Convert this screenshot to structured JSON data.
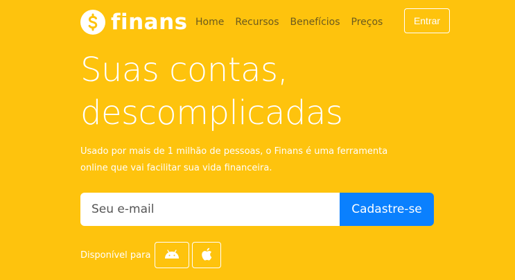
{
  "brand": {
    "name": "finans",
    "logo_icon": "dollar-coin-icon"
  },
  "nav": {
    "items": [
      {
        "label": "Home"
      },
      {
        "label": "Recursos"
      },
      {
        "label": "Benefícios"
      },
      {
        "label": "Preços"
      }
    ],
    "login_label": "Entrar"
  },
  "hero": {
    "headline_line1": "Suas contas,",
    "headline_line2": "descomplicadas",
    "subtitle": "Usado por mais de 1 milhão de pessoas, o Finans é uma ferramenta online que vai facilitar sua vida financeira."
  },
  "signup": {
    "placeholder": "Seu e-mail",
    "button_label": "Cadastre-se"
  },
  "availability": {
    "label": "Disponível para",
    "platforms": [
      {
        "icon": "android-icon"
      },
      {
        "icon": "apple-icon"
      }
    ]
  },
  "colors": {
    "background": "#FEC30D",
    "accent": "#0A80FE",
    "nav_text": "#6b5a1e"
  }
}
